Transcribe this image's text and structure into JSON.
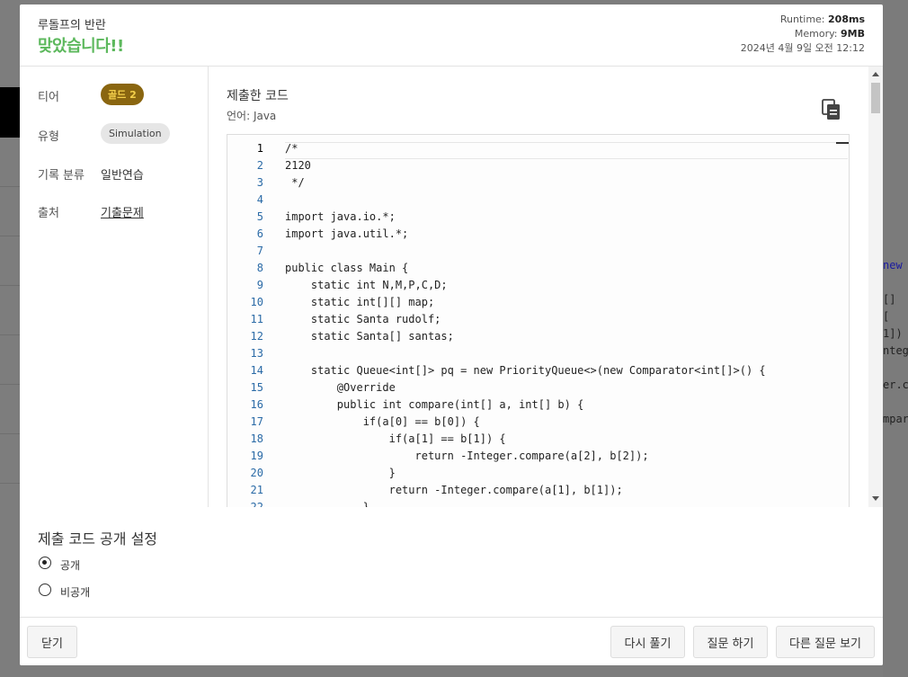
{
  "header": {
    "subtitle": "루돌프의 반란",
    "result": "맞았습니다!!",
    "runtime_label": "Runtime:",
    "runtime_value": "208ms",
    "memory_label": "Memory:",
    "memory_value": "9MB",
    "datetime": "2024년 4월 9일 오전 12:12"
  },
  "sidebar": {
    "tier_label": "티어",
    "tier_value": "골드 2",
    "type_label": "유형",
    "type_value": "Simulation",
    "record_label": "기록 분류",
    "record_value": "일반연습",
    "source_label": "출처",
    "source_value": "기출문제"
  },
  "code": {
    "title": "제출한 코드",
    "language": "언어: Java",
    "lines": [
      "/*",
      "2120",
      " */",
      "",
      "import java.io.*;",
      "import java.util.*;",
      "",
      "public class Main {",
      "    static int N,M,P,C,D;",
      "    static int[][] map;",
      "    static Santa rudolf;",
      "    static Santa[] santas;",
      "",
      "    static Queue<int[]> pq = new PriorityQueue<>(new Comparator<int[]>() {",
      "        @Override",
      "        public int compare(int[] a, int[] b) {",
      "            if(a[0] == b[0]) {",
      "                if(a[1] == b[1]) {",
      "                    return -Integer.compare(a[2], b[2]);",
      "                }",
      "                return -Integer.compare(a[1], b[1]);",
      "            }"
    ]
  },
  "visibility": {
    "title": "제출 코드 공개 설정",
    "public_label": "공개",
    "private_label": "비공개",
    "selected": "공개"
  },
  "footer": {
    "close": "닫기",
    "retry": "다시 풀기",
    "ask": "질문 하기",
    "other_questions": "다른 질문 보기"
  },
  "background": {
    "snippets": [
      "new",
      "[]",
      "[",
      "1])",
      "nteg",
      "er.c",
      "mpar"
    ]
  },
  "colors": {
    "accepted": "#5cb85c",
    "gold_badge_bg": "#8a6610",
    "gold_badge_text": "#f5d04b"
  }
}
